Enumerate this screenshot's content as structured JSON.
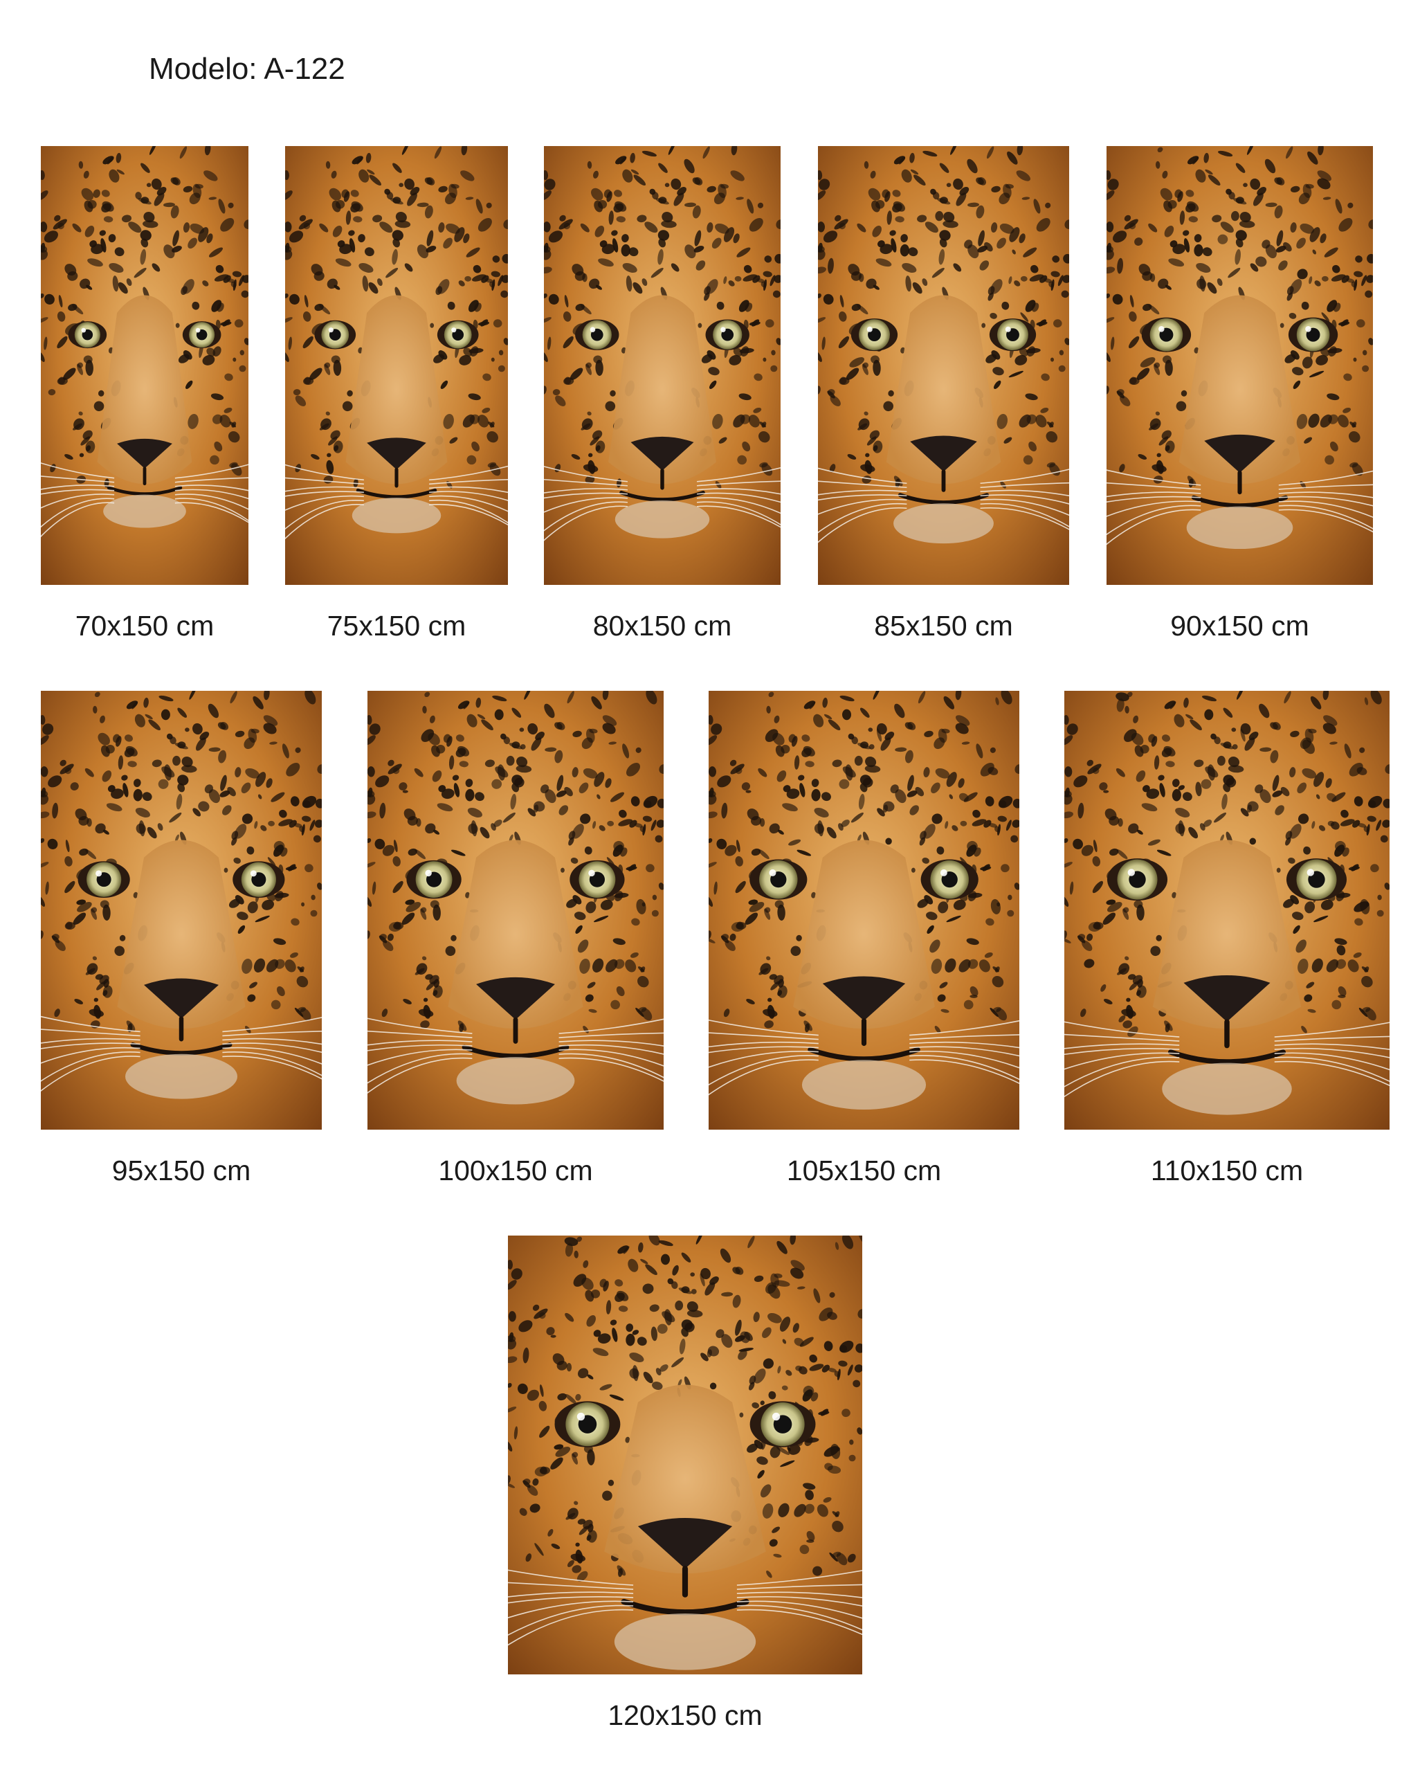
{
  "model": {
    "title": "Modelo: A-122"
  },
  "image_subject": "leopard-face-photo",
  "colors": {
    "background": "#ffffff",
    "text": "#1a1a1a",
    "fur_dark": "#7a3f12",
    "fur_mid": "#c47a2c",
    "fur_light": "#e9b46a",
    "spots": "#1e130b",
    "eyes": "#c9c58a",
    "nose": "#231a17"
  },
  "sizes": [
    {
      "label": "70x150 cm",
      "width_cm": 70,
      "height_cm": 150
    },
    {
      "label": "75x150 cm",
      "width_cm": 75,
      "height_cm": 150
    },
    {
      "label": "80x150 cm",
      "width_cm": 80,
      "height_cm": 150
    },
    {
      "label": "85x150 cm",
      "width_cm": 85,
      "height_cm": 150
    },
    {
      "label": "90x150 cm",
      "width_cm": 90,
      "height_cm": 150
    },
    {
      "label": "95x150 cm",
      "width_cm": 95,
      "height_cm": 150
    },
    {
      "label": "100x150 cm",
      "width_cm": 100,
      "height_cm": 150
    },
    {
      "label": "105x150 cm",
      "width_cm": 105,
      "height_cm": 150
    },
    {
      "label": "110x150 cm",
      "width_cm": 110,
      "height_cm": 150
    },
    {
      "label": "120x150 cm",
      "width_cm": 120,
      "height_cm": 150
    }
  ]
}
